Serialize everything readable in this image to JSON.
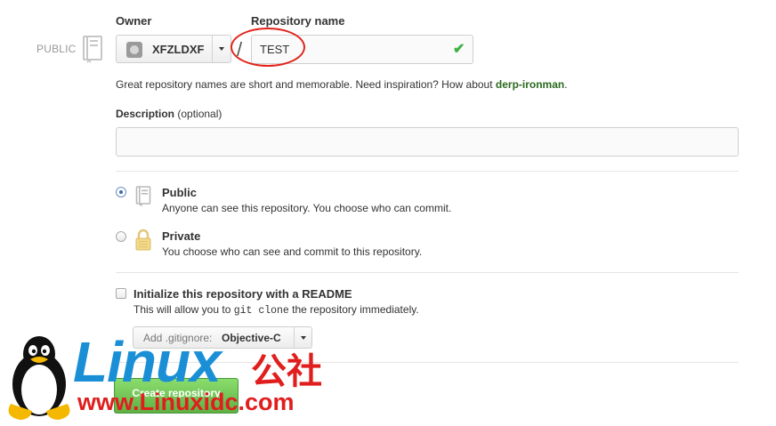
{
  "owner": {
    "label": "Owner",
    "visibility_tag": "PUBLIC",
    "selected": "XFZLDXF"
  },
  "repository": {
    "label": "Repository name",
    "separator": "/",
    "value": "TEST",
    "valid_mark": "✔",
    "hint_prefix": "Great repository names are short and memorable. Need inspiration? How about ",
    "hint_suggestion": "derp-ironman",
    "hint_suffix": "."
  },
  "description": {
    "label": "Description",
    "label_suffix": " (optional)",
    "value": ""
  },
  "visibility": {
    "selected": "public",
    "options": [
      {
        "id": "public",
        "title": "Public",
        "desc": "Anyone can see this repository. You choose who can commit."
      },
      {
        "id": "private",
        "title": "Private",
        "desc": "You choose who can see and commit to this repository."
      }
    ]
  },
  "init": {
    "checked": false,
    "label": "Initialize this repository with a README",
    "desc_prefix": "This will allow you to ",
    "desc_code": "git clone",
    "desc_suffix": " the repository immediately."
  },
  "gitignore": {
    "label": "Add .gitignore:",
    "value": "Objective-C"
  },
  "create_button": {
    "label": "Create repository"
  },
  "watermark": {
    "brand": "Linux",
    "brand_cn": "公社",
    "url": "www.Linuxidc.com"
  },
  "colors": {
    "accent_green": "#60b044",
    "suggestion_green": "#2a6a1e",
    "annotation_red": "#e2231a",
    "watermark_blue": "#1b8fd6",
    "watermark_red": "#e01e1e"
  },
  "icons": [
    "repo-book-icon",
    "github-avatar-icon",
    "chevron-down-icon",
    "check-icon",
    "lock-icon",
    "tux-penguin-icon"
  ]
}
